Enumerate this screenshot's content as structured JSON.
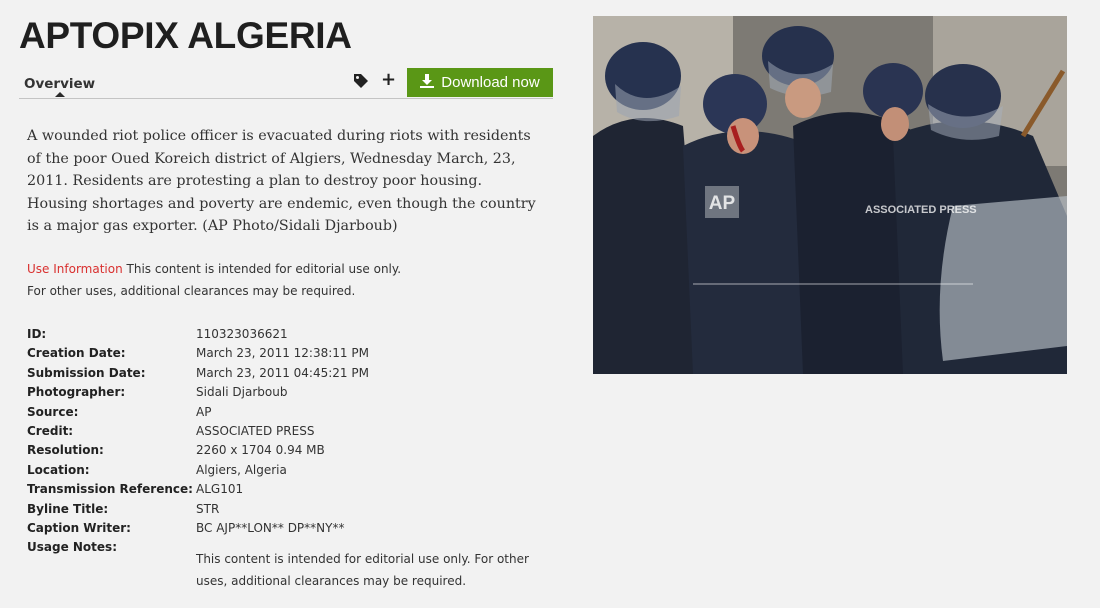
{
  "page": {
    "title": "APTOPIX ALGERIA"
  },
  "tabs": {
    "overview_label": "Overview"
  },
  "actions": {
    "tag_icon": "tag-icon",
    "plus_icon": "plus-icon",
    "plus_glyph": "+",
    "download_label": "Download now",
    "download_icon": "download-icon",
    "download_color": "#5a9716"
  },
  "caption": "A wounded riot police officer is evacuated during riots with residents of the poor Oued Koreich district of Algiers, Wednesday March, 23, 2011. Residents are protesting a plan to destroy poor housing. Housing shortages and poverty are endemic, even though the country is a major gas exporter. (AP Photo/Sidali Djarboub)",
  "use_info": {
    "link_label": "Use Information",
    "line1": " This content is intended for editorial use only.",
    "line2": "For other uses, additional clearances may be required.",
    "link_color": "#d9302f"
  },
  "metadata": [
    {
      "key": "ID:",
      "value": "110323036621"
    },
    {
      "key": "Creation Date:",
      "value": "March 23, 2011 12:38:11 PM"
    },
    {
      "key": "Submission Date:",
      "value": "March 23, 2011 04:45:21 PM"
    },
    {
      "key": "Photographer:",
      "value": "Sidali Djarboub"
    },
    {
      "key": "Source:",
      "value": "AP"
    },
    {
      "key": "Credit:",
      "value": "ASSOCIATED PRESS"
    },
    {
      "key": "Resolution:",
      "value": "2260 x 1704 0.94 MB"
    },
    {
      "key": "Location:",
      "value": "Algiers, Algeria"
    },
    {
      "key": "Transmission Reference:",
      "value": "ALG101"
    },
    {
      "key": "Byline Title:",
      "value": "STR"
    },
    {
      "key": "Caption Writer:",
      "value": "BC AJP**LON** DP**NY**"
    },
    {
      "key": "Usage Notes:",
      "value": ""
    }
  ],
  "usage_notes": "This content is intended for editorial use only. For other uses, additional clearances may be required.",
  "photo": {
    "watermark_logo": "AP",
    "watermark_text": "ASSOCIATED PRESS"
  }
}
